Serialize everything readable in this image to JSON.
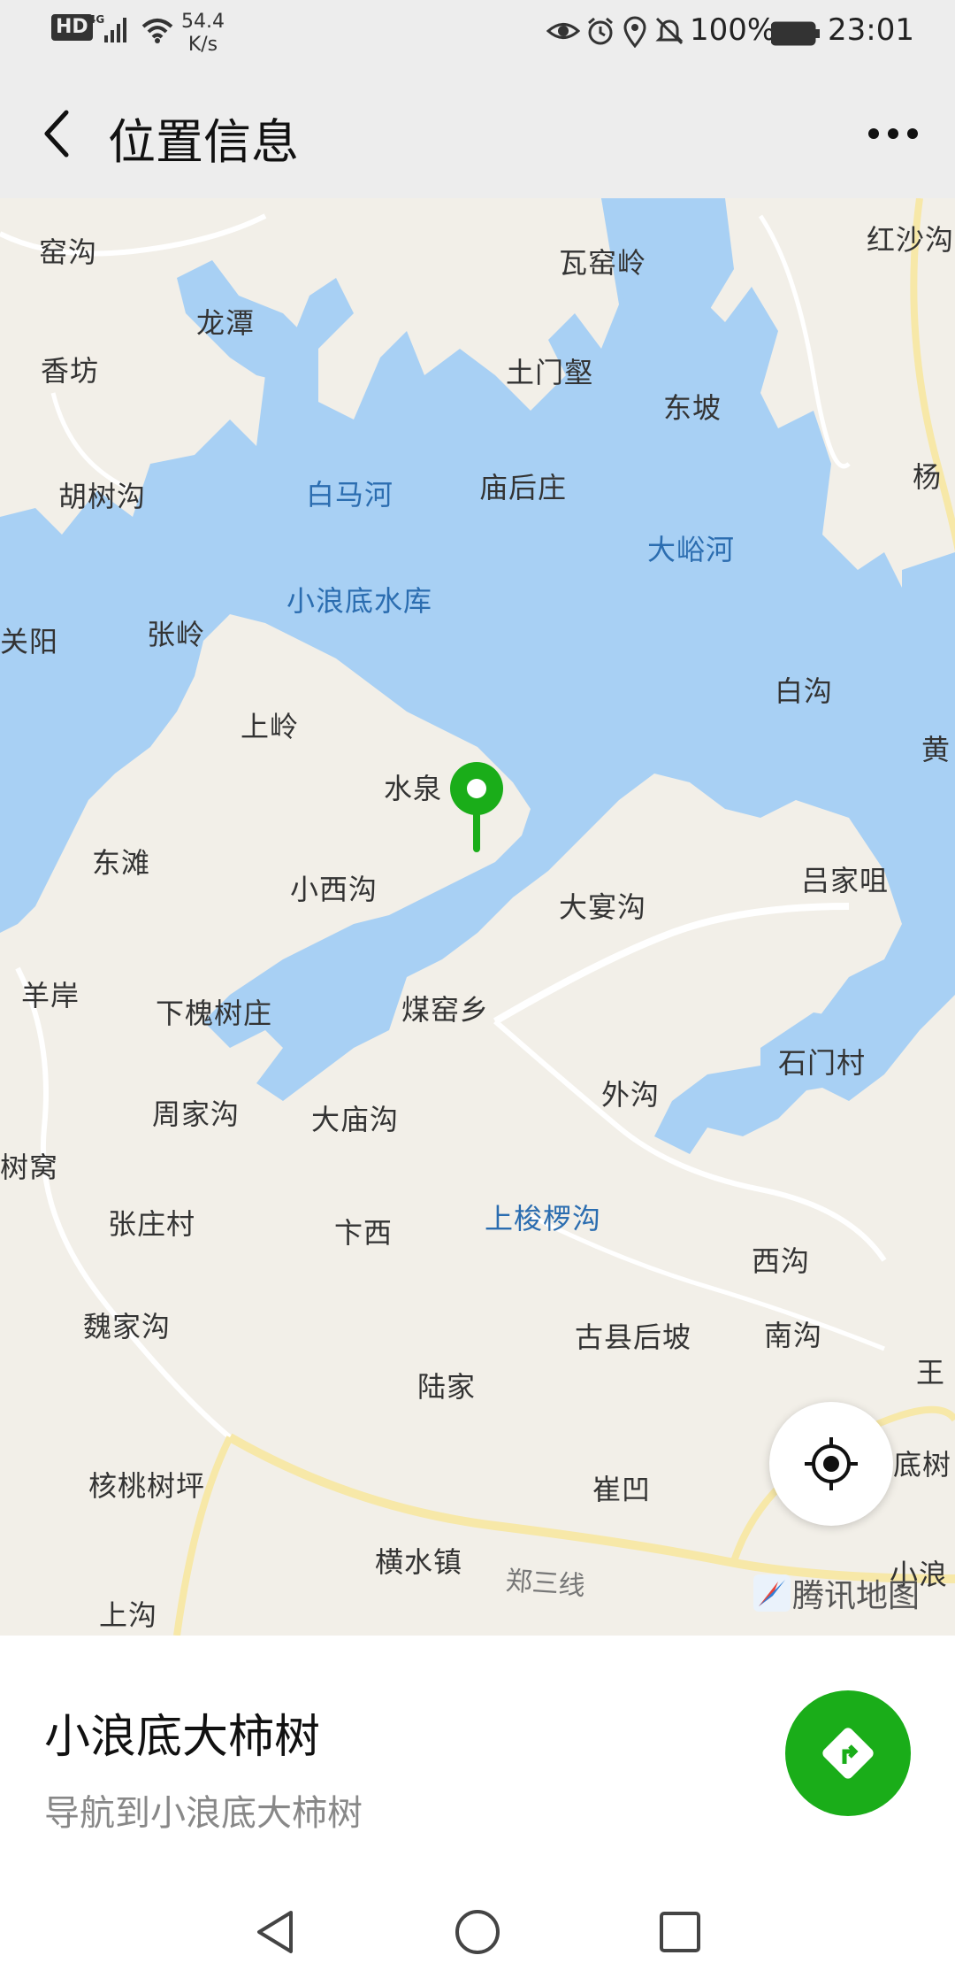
{
  "status_bar": {
    "hd": "HD",
    "network": "4G",
    "net_speed_value": "54.4",
    "net_speed_unit": "K/s",
    "battery": "100%",
    "time": "23:01",
    "icons": [
      "eye-icon",
      "alarm-icon",
      "location-icon",
      "mute-icon",
      "battery-icon"
    ]
  },
  "header": {
    "title": "位置信息",
    "back_icon": "chevron-left-icon",
    "more_icon": "more-horizontal-icon"
  },
  "map": {
    "provider": "腾讯地图",
    "colors": {
      "land": "#f2efe8",
      "water": "#a8d0f4",
      "marker": "#1aad19"
    },
    "water_labels": {
      "baimahe": "白马河",
      "reservoir": "小浪底水库",
      "dayuhe": "大峪河",
      "shangsuoluogou": "上梭椤沟"
    },
    "place_labels": {
      "yaogou": "窑沟",
      "longtan": "龙潭",
      "xiangfang": "香坊",
      "hushugou": "胡树沟",
      "guanyang": "关阳",
      "zhangling": "张岭",
      "shangling": "上岭",
      "dongtan": "东滩",
      "yangan": "羊岸",
      "xiahuaishuzhuang": "下槐树庄",
      "zhoujiagou": "周家沟",
      "shuwo": "树窝",
      "zhangzhuangcun": "张庄村",
      "weijiagou": "魏家沟",
      "hetaoshuping": "核桃树坪",
      "shanggou": "上沟",
      "hongshagou": "红沙沟",
      "wayaoling": "瓦窑岭",
      "tumenqian": "土门壑",
      "dongpo": "东坡",
      "miaohouzhuang": "庙后庄",
      "baigou": "白沟",
      "huang": "黄",
      "shuiquan": "水泉",
      "xiaoxigou": "小西沟",
      "dayangou": "大宴沟",
      "lujiaju": "吕家咀",
      "meiyaoxiang": "煤窑乡",
      "damiaogou": "大庙沟",
      "shimencun": "石门村",
      "waigou": "外沟",
      "kaxi": "卞西",
      "xigou": "西沟",
      "guxianhoupo": "古县后坡",
      "nangou": "南沟",
      "lujia": "陆家",
      "cuiao": "崔凹",
      "hengshuizhen": "横水镇",
      "yang": "杨",
      "xiaolang": "小浪",
      "dishu": "底树",
      "wang": "王"
    },
    "road_labels": {
      "zhengsan": "郑三线"
    },
    "locate_icon": "locate-target-icon",
    "marker_icon": "map-pin-icon"
  },
  "panel": {
    "place_name": "小浪底大柿树",
    "nav_text": "导航到小浪底大柿树",
    "nav_icon": "navigate-icon"
  },
  "nav_bar": {
    "icons": [
      "back-triangle-icon",
      "home-circle-icon",
      "recents-square-icon"
    ]
  }
}
